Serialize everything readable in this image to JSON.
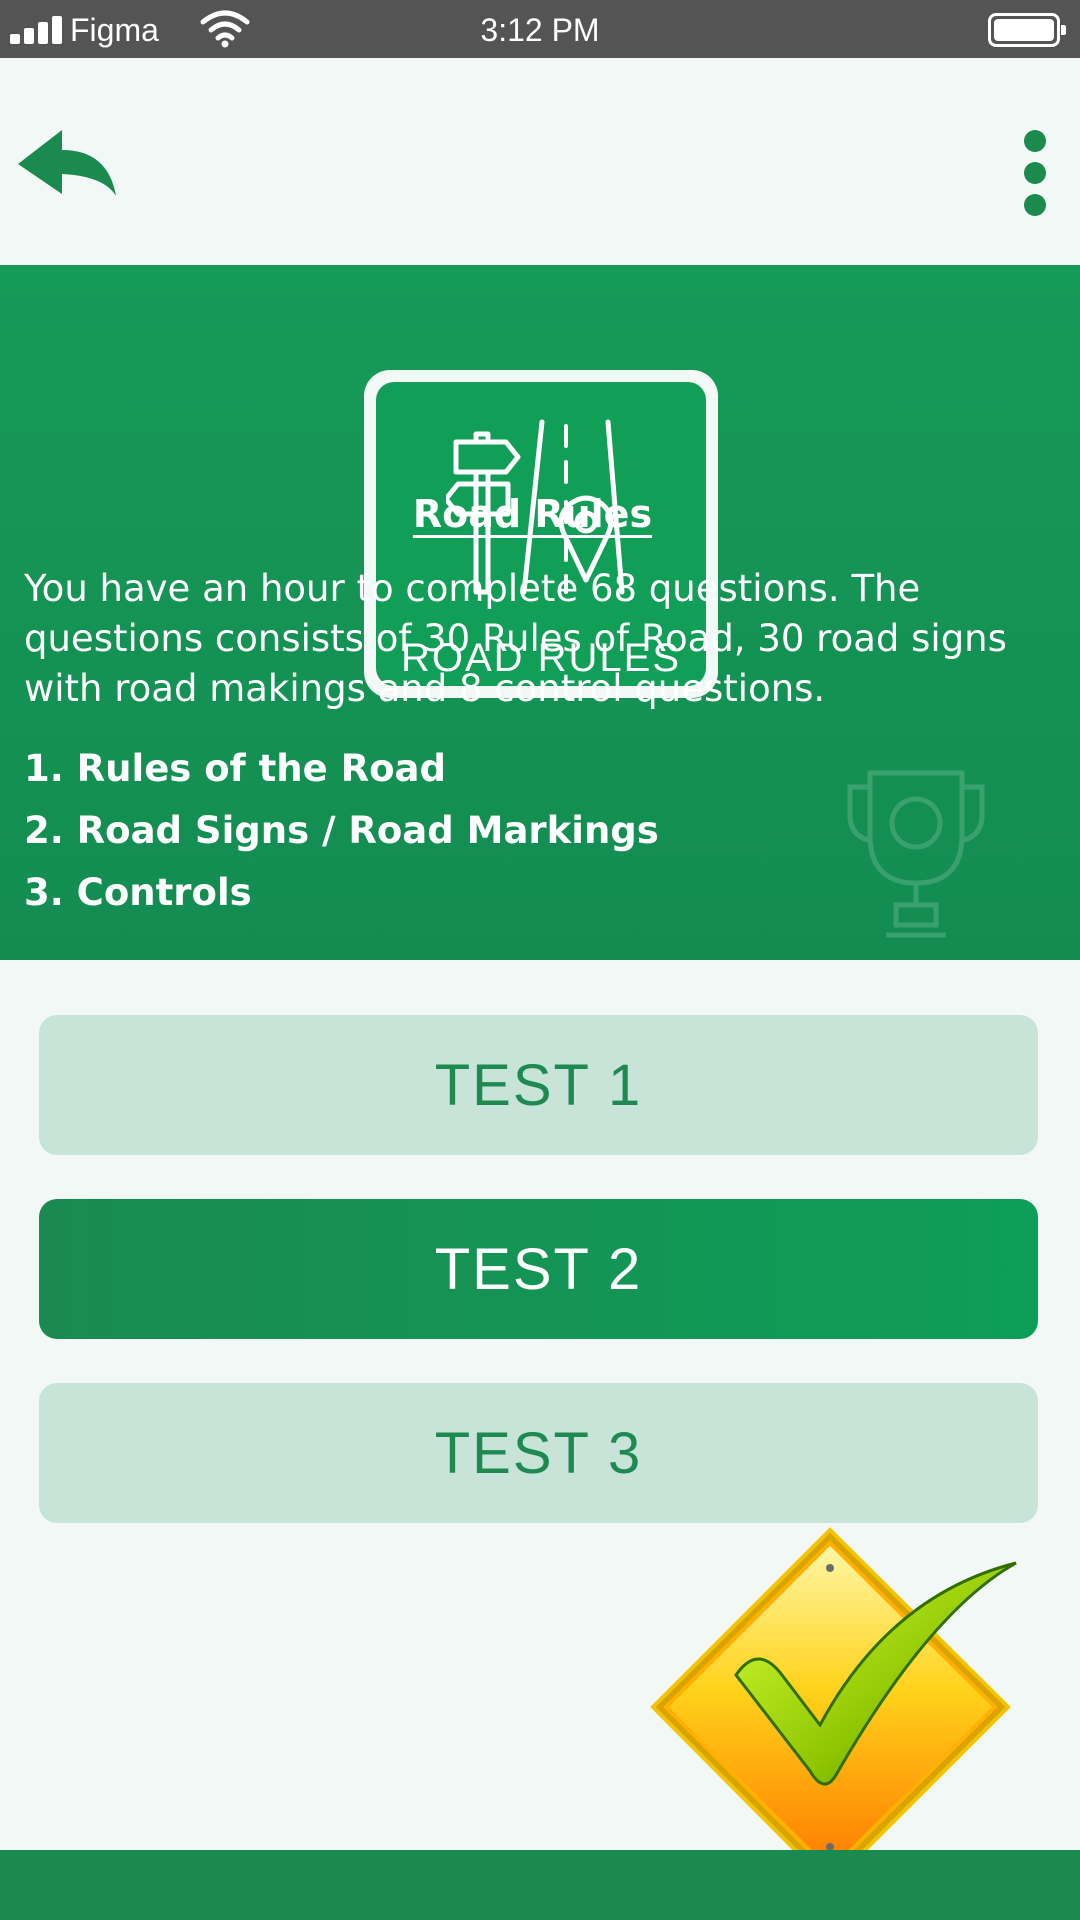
{
  "status_bar": {
    "carrier": "Figma",
    "time": "3:12 PM"
  },
  "header": {
    "back_icon": "back-arrow-icon",
    "more_icon": "more-vertical-icon"
  },
  "badge": {
    "icon": "signpost-road-pin-icon",
    "label": "ROAD RULES"
  },
  "content": {
    "title": "Road Rules",
    "description": "You have an hour to complete 68 questions. The questions consists of 30 Rules of Road, 30 road signs with road makings and 8 control questions.",
    "items": [
      "1. Rules of the Road",
      "2. Road Signs / Road Markings",
      "3. Controls"
    ],
    "watermark_icon": "trophy-icon"
  },
  "tests": [
    {
      "label": "TEST 1",
      "state": "inactive"
    },
    {
      "label": "TEST 2",
      "state": "active"
    },
    {
      "label": "TEST 3",
      "state": "inactive"
    }
  ],
  "decoration": {
    "icon": "checkmark-road-sign-icon"
  },
  "colors": {
    "primary_green": "#119e57",
    "dark_green": "#1b8a4e",
    "light_green": "#c8e4d8",
    "background": "#f2f8f6",
    "status_bar": "#545454"
  }
}
